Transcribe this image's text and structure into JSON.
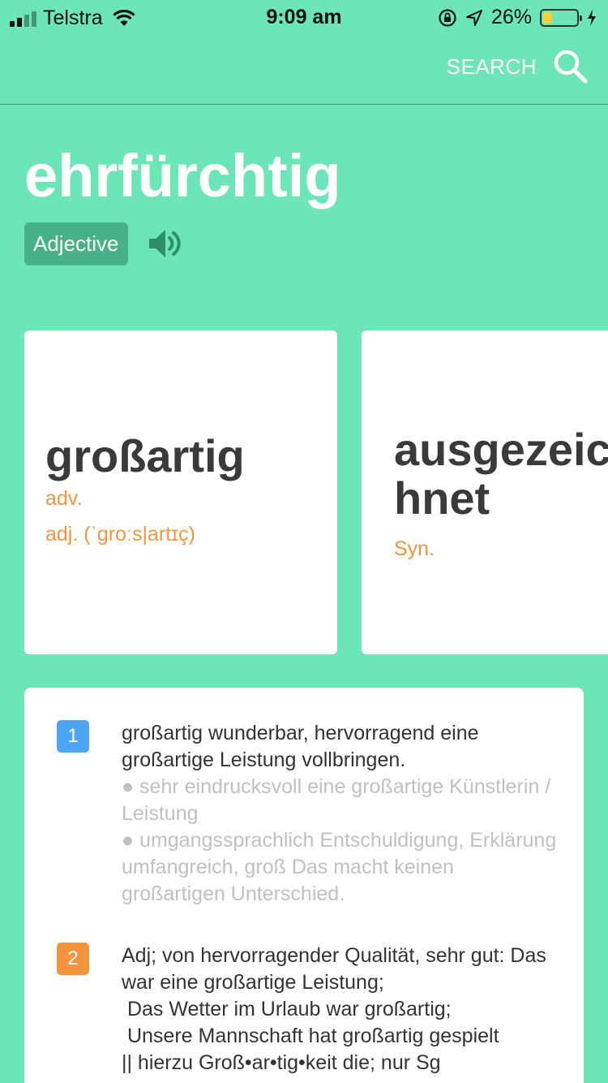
{
  "status_bar": {
    "carrier": "Telstra",
    "time": "9:09 am",
    "battery": "26%",
    "battery_level": 0.26
  },
  "topbar": {
    "search_label": "SEARCH"
  },
  "entry": {
    "word": "ehrfürchtig",
    "part_of_speech": "Adjective"
  },
  "cards": [
    {
      "word": "großartig",
      "lines": [
        "adv.",
        "adj. (ˈgroːs|artɪç)"
      ]
    },
    {
      "word": "ausgezeichnet",
      "lines": [
        "Syn."
      ]
    }
  ],
  "definitions": [
    {
      "number": "1",
      "main": "großartig wunderbar, hervorragend eine großartige Leistung vollbringen.",
      "notes": [
        "● sehr eindrucksvoll eine großartige Künstlerin / Leistung",
        "● umgangssprachlich Entschuldigung, Erklärung umfangreich, groß Das macht keinen großartigen Unterschied."
      ]
    },
    {
      "number": "2",
      "main": "Adj; von hervorragender Qualität, sehr gut: Das war eine großartige Leistung;\n Das Wetter im Urlaub war großartig;\n Unsere Mannschaft hat großartig gespielt\n|| hierzu Groß•ar•tig•keit die; nur Sg"
    }
  ],
  "colors": {
    "background": "#6ce6b6",
    "badge": "#47b287",
    "accent_orange": "#f2953e",
    "accent_blue": "#4da6f3"
  }
}
